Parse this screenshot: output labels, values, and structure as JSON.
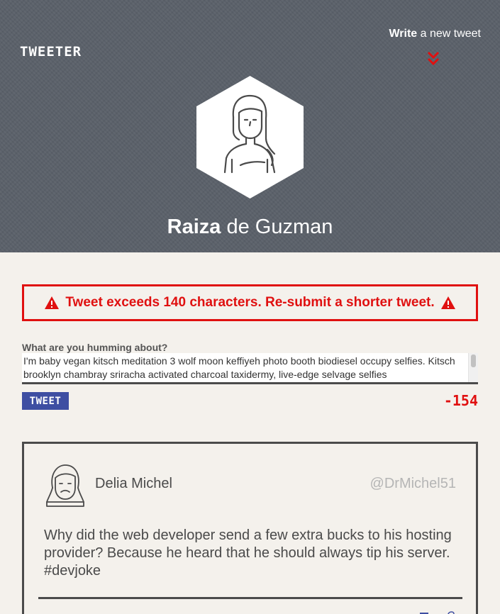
{
  "header": {
    "logo": "TWEETER",
    "compose_bold": "Write",
    "compose_rest": " a new tweet",
    "profile_first": "Raiza",
    "profile_last": " de Guzman"
  },
  "error": {
    "message": "Tweet exceeds 140 characters. Re-submit a shorter tweet."
  },
  "compose": {
    "label": "What are you humming about?",
    "value": "I'm baby vegan kitsch meditation 3 wolf moon keffiyeh photo booth biodiesel occupy selfies. Kitsch brooklyn chambray sriracha activated charcoal taxidermy, live-edge selvage selfies",
    "button_label": "TWEET",
    "char_count": "-154"
  },
  "tweets": [
    {
      "name": "Delia Michel",
      "handle": "@DrMichel51",
      "text": "Why did the web developer send a few extra bucks to his hosting provider? Because he heard that he should always tip his server. #devjoke"
    }
  ],
  "colors": {
    "header_bg": "#5a6069",
    "page_bg": "#f4f1ec",
    "error_red": "#e01010",
    "button_blue": "#3e4ea2",
    "border_dark": "#4b4b4b",
    "handle_gray": "#b5b5b5"
  },
  "icons": [
    "chevron-down-double-icon",
    "warning-icon",
    "avatar-icon",
    "flag-icon",
    "heart-icon"
  ]
}
